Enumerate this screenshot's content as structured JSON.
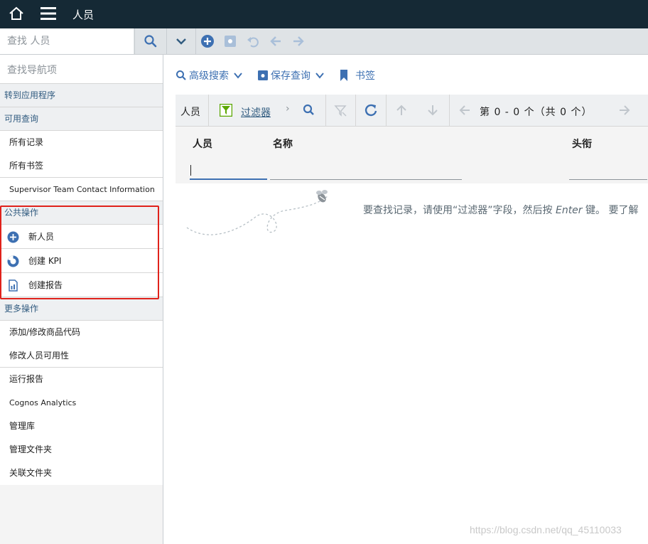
{
  "header": {
    "title": "人员"
  },
  "search": {
    "placeholder": "查找 人员"
  },
  "sidebar": {
    "nav_search_placeholder": "查找导航项",
    "goto_app": "转到应用程序",
    "available_queries": "可用查询",
    "queries": [
      "所有记录",
      "所有书签",
      "Supervisor Team Contact Information"
    ],
    "common_actions": "公共操作",
    "actions": [
      "新人员",
      "创建 KPI",
      "创建报告"
    ],
    "more_actions": "更多操作",
    "more": [
      "添加/修改商品代码",
      "修改人员可用性",
      "运行报告",
      "Cognos Analytics",
      "管理库",
      "管理文件夹",
      "关联文件夹"
    ]
  },
  "main": {
    "advanced_search": "高级搜索",
    "save_query": "保存查询",
    "bookmarks": "书签",
    "toolbar_label": "人员",
    "filter": "过滤器",
    "paging": "第 0 - 0 个（共 0 个）",
    "columns": [
      "人员",
      "名称",
      "头衔"
    ],
    "hint_prefix": "要查找记录，请使用“过滤器”字段，然后按 ",
    "hint_key": "Enter",
    "hint_suffix": " 键。 要了解"
  },
  "watermark": "https://blog.csdn.net/qq_45110033",
  "colors": {
    "header_bg": "#152935",
    "accent": "#3d70b2",
    "highlight_border": "#e0221b",
    "filter_green": "#5aa700"
  }
}
